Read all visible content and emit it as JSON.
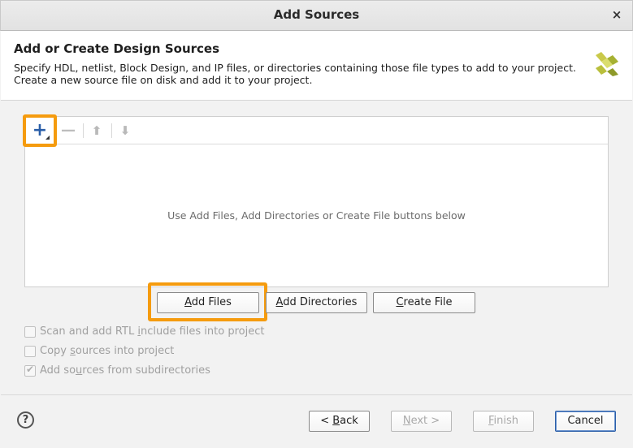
{
  "window": {
    "title": "Add Sources",
    "close_glyph": "×"
  },
  "header": {
    "title": "Add or Create Design Sources",
    "description_line1": "Specify HDL, netlist, Block Design, and IP files, or directories containing those file types to add to your project.",
    "description_line2": "Create a new source file on disk and add it to your project.",
    "logo_icon": "xilinx-logo-icon",
    "logo_color": "#c7c73a"
  },
  "file_list": {
    "toolbar": {
      "add_glyph": "+",
      "remove_glyph": "—",
      "up_glyph": "⬆",
      "down_glyph": "⬇"
    },
    "empty_message": "Use Add Files, Add Directories or Create File buttons below"
  },
  "actions": {
    "add_files": {
      "mnemonic": "A",
      "rest": "dd Files"
    },
    "add_directories": {
      "mnemonic": "A",
      "rest": "dd Directories"
    },
    "create_file": {
      "mnemonic": "C",
      "rest": "reate File"
    }
  },
  "options": [
    {
      "pre": "Scan and add RTL ",
      "mnemonic": "i",
      "post": "nclude files into project",
      "checked": false,
      "enabled": false
    },
    {
      "pre": "Copy ",
      "mnemonic": "s",
      "post": "ources into project",
      "checked": false,
      "enabled": false
    },
    {
      "pre": "Add so",
      "mnemonic": "u",
      "post": "rces from subdirectories",
      "checked": true,
      "enabled": false
    }
  ],
  "footer": {
    "help_glyph": "?",
    "back": {
      "pre": "< ",
      "mnemonic": "B",
      "post": "ack"
    },
    "next": {
      "pre": "",
      "mnemonic": "N",
      "post": "ext >"
    },
    "finish": {
      "pre": "",
      "mnemonic": "F",
      "post": "inish"
    },
    "cancel": "Cancel"
  },
  "colors": {
    "highlight": "#f59b0e",
    "accent": "#2a5ea8"
  }
}
